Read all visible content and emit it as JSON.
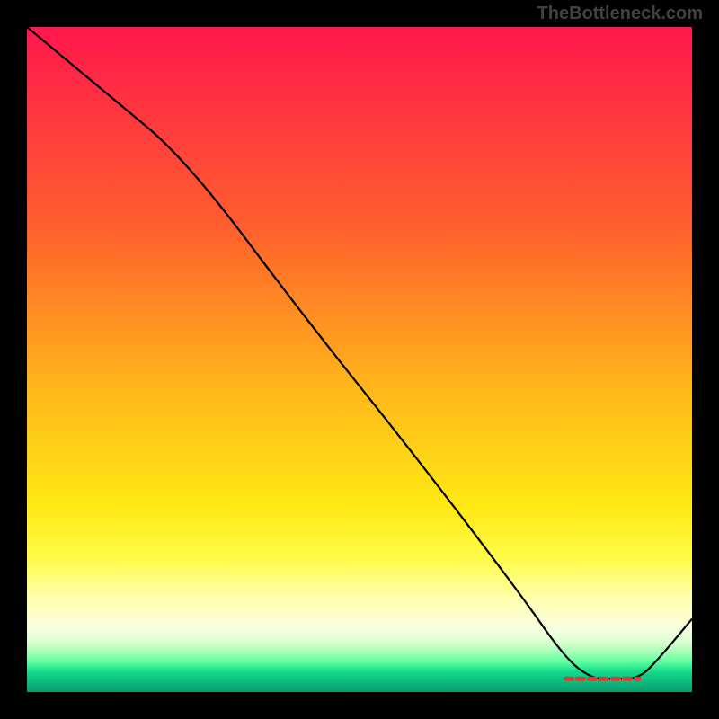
{
  "watermark": "TheBottleneck.com",
  "gradient_stops": [
    {
      "offset": 0.0,
      "color": "#ff174c"
    },
    {
      "offset": 0.3,
      "color": "#ff5f2d"
    },
    {
      "offset": 0.55,
      "color": "#ffb91a"
    },
    {
      "offset": 0.72,
      "color": "#ffe914"
    },
    {
      "offset": 0.8,
      "color": "#fffb4a"
    },
    {
      "offset": 0.86,
      "color": "#ffffb0"
    },
    {
      "offset": 0.905,
      "color": "#f7ffe0"
    },
    {
      "offset": 0.925,
      "color": "#d9ffcf"
    },
    {
      "offset": 0.94,
      "color": "#a2ffb6"
    },
    {
      "offset": 0.955,
      "color": "#5affa1"
    },
    {
      "offset": 0.97,
      "color": "#11d98c"
    },
    {
      "offset": 1.0,
      "color": "#0a9a6e"
    }
  ],
  "chart_data": {
    "type": "line",
    "title": "",
    "xlabel": "",
    "ylabel": "",
    "xlim": [
      0,
      100
    ],
    "ylim": [
      0,
      100
    ],
    "series": [
      {
        "name": "curve",
        "x": [
          0,
          12,
          24,
          42,
          58,
          74,
          81,
          85,
          88,
          92,
          95,
          100
        ],
        "values": [
          100,
          90,
          80,
          56,
          36,
          15,
          5,
          2,
          2,
          2,
          5,
          11
        ]
      }
    ],
    "band": {
      "x_start": 81,
      "x_end": 92,
      "y": 2
    }
  }
}
